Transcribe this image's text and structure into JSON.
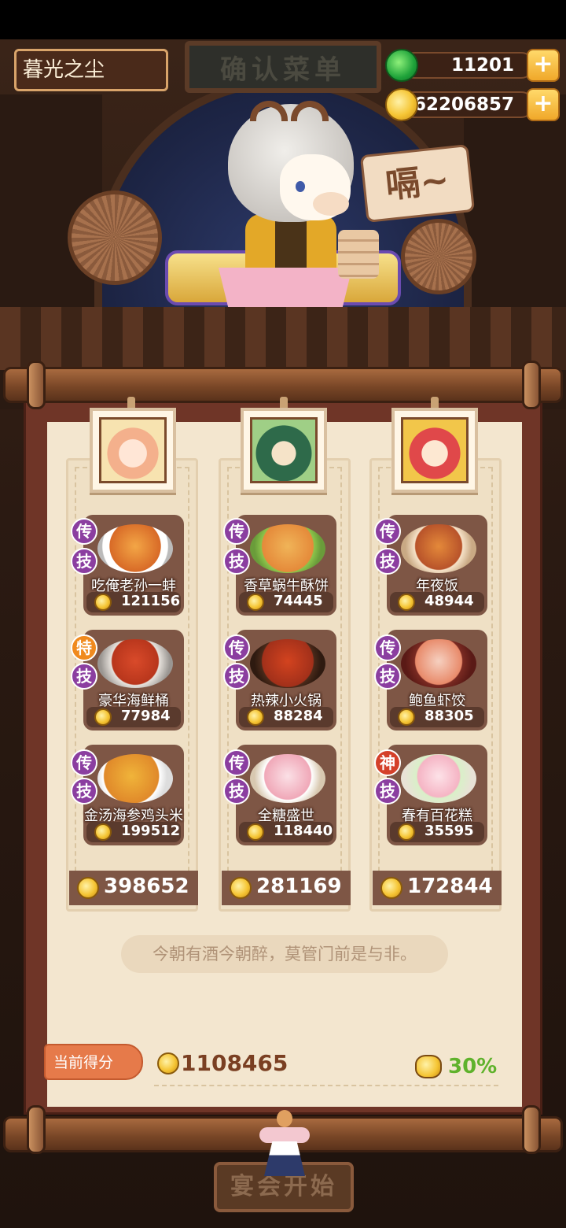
{
  "header": {
    "player_name": "暮光之尘",
    "title": "确认菜单",
    "jade": "11201",
    "coins": "62206857"
  },
  "speech_bubble": "嗝~",
  "columns": [
    {
      "dishes": [
        {
          "badge1": "传",
          "badge2": "技",
          "name": "吃俺老孙一蚌",
          "price": "121156"
        },
        {
          "badge1": "特",
          "badge2": "技",
          "name": "豪华海鲜桶",
          "price": "77984"
        },
        {
          "badge1": "传",
          "badge2": "技",
          "name": "金汤海参鸡头米",
          "price": "199512"
        }
      ],
      "total": "398652"
    },
    {
      "dishes": [
        {
          "badge1": "传",
          "badge2": "技",
          "name": "香草蜗牛酥饼",
          "price": "74445"
        },
        {
          "badge1": "传",
          "badge2": "技",
          "name": "热辣小火锅",
          "price": "88284"
        },
        {
          "badge1": "传",
          "badge2": "技",
          "name": "全糖盛世",
          "price": "118440"
        }
      ],
      "total": "281169"
    },
    {
      "dishes": [
        {
          "badge1": "传",
          "badge2": "技",
          "name": "年夜饭",
          "price": "48944"
        },
        {
          "badge1": "传",
          "badge2": "技",
          "name": "鲍鱼虾饺",
          "price": "88305"
        },
        {
          "badge1": "神",
          "badge2": "技",
          "name": "春有百花糕",
          "price": "35595"
        }
      ],
      "total": "172844"
    }
  ],
  "quote": "今朝有酒今朝醉，莫管门前是与非。",
  "score": {
    "label": "当前得分",
    "value": "1108465",
    "percent": "30%"
  },
  "start_button": "宴会开始",
  "colors": {
    "scroll_red": "#6f3527",
    "paper": "#f3e6cf",
    "score_orange": "#e67a4a",
    "percent_green": "#5fb22c"
  }
}
